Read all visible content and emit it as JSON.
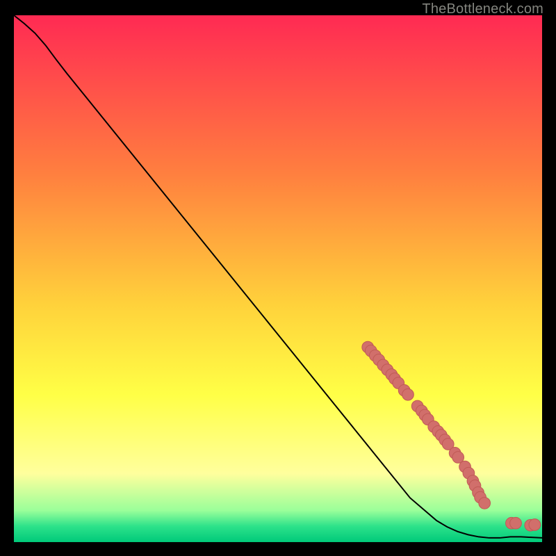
{
  "header": {
    "attribution": "TheBottleneck.com"
  },
  "colors": {
    "page_bg": "#000000",
    "gradient_top": "#ff2a53",
    "gradient_mid_hi": "#ff7f3f",
    "gradient_mid": "#ffd23b",
    "gradient_mid_lo": "#ffff46",
    "gradient_pale": "#ffff9d",
    "gradient_green_a": "#9aff9a",
    "gradient_green_b": "#2de28a",
    "gradient_bottom": "#00c97a",
    "curve": "#000000",
    "point_fill": "#d16f6b",
    "point_stroke": "#c05a55"
  },
  "chart_data": {
    "type": "line",
    "title": "",
    "xlabel": "",
    "ylabel": "",
    "xlim": [
      0,
      100
    ],
    "ylim": [
      0,
      100
    ],
    "grid": false,
    "legend": false,
    "curve": [
      {
        "x": 0.0,
        "y": 100.0
      },
      {
        "x": 2.0,
        "y": 98.4
      },
      {
        "x": 4.0,
        "y": 96.6
      },
      {
        "x": 6.0,
        "y": 94.3
      },
      {
        "x": 8.0,
        "y": 91.6
      },
      {
        "x": 10.0,
        "y": 89.0
      },
      {
        "x": 15.0,
        "y": 82.8
      },
      {
        "x": 20.0,
        "y": 76.6
      },
      {
        "x": 25.0,
        "y": 70.4
      },
      {
        "x": 30.0,
        "y": 64.2
      },
      {
        "x": 35.0,
        "y": 58.0
      },
      {
        "x": 40.0,
        "y": 51.8
      },
      {
        "x": 45.0,
        "y": 45.6
      },
      {
        "x": 50.0,
        "y": 39.4
      },
      {
        "x": 55.0,
        "y": 33.2
      },
      {
        "x": 60.0,
        "y": 27.0
      },
      {
        "x": 65.0,
        "y": 20.8
      },
      {
        "x": 70.0,
        "y": 14.6
      },
      {
        "x": 75.0,
        "y": 8.4
      },
      {
        "x": 80.0,
        "y": 4.1
      },
      {
        "x": 82.0,
        "y": 2.9
      },
      {
        "x": 84.0,
        "y": 2.0
      },
      {
        "x": 86.0,
        "y": 1.4
      },
      {
        "x": 88.0,
        "y": 1.0
      },
      {
        "x": 90.0,
        "y": 0.8
      },
      {
        "x": 92.0,
        "y": 0.8
      },
      {
        "x": 94.0,
        "y": 1.0
      },
      {
        "x": 96.0,
        "y": 1.0
      },
      {
        "x": 98.0,
        "y": 0.9
      },
      {
        "x": 100.0,
        "y": 0.8
      }
    ],
    "points": [
      {
        "x": 67.0,
        "y": 37.0
      },
      {
        "x": 67.6,
        "y": 36.3
      },
      {
        "x": 68.4,
        "y": 35.4
      },
      {
        "x": 69.1,
        "y": 34.6
      },
      {
        "x": 69.9,
        "y": 33.6
      },
      {
        "x": 70.7,
        "y": 32.7
      },
      {
        "x": 71.5,
        "y": 31.8
      },
      {
        "x": 72.1,
        "y": 31.0
      },
      {
        "x": 72.8,
        "y": 30.2
      },
      {
        "x": 73.9,
        "y": 28.8
      },
      {
        "x": 74.6,
        "y": 28.0
      },
      {
        "x": 76.4,
        "y": 25.8
      },
      {
        "x": 77.2,
        "y": 24.9
      },
      {
        "x": 77.8,
        "y": 24.1
      },
      {
        "x": 78.4,
        "y": 23.3
      },
      {
        "x": 79.5,
        "y": 21.9
      },
      {
        "x": 80.3,
        "y": 21.0
      },
      {
        "x": 80.9,
        "y": 20.3
      },
      {
        "x": 81.6,
        "y": 19.4
      },
      {
        "x": 82.2,
        "y": 18.6
      },
      {
        "x": 83.5,
        "y": 16.9
      },
      {
        "x": 84.1,
        "y": 16.1
      },
      {
        "x": 85.4,
        "y": 14.3
      },
      {
        "x": 86.1,
        "y": 13.1
      },
      {
        "x": 86.9,
        "y": 11.6
      },
      {
        "x": 87.3,
        "y": 10.7
      },
      {
        "x": 87.9,
        "y": 9.4
      },
      {
        "x": 88.3,
        "y": 8.5
      },
      {
        "x": 89.1,
        "y": 7.4
      },
      {
        "x": 94.2,
        "y": 3.6
      },
      {
        "x": 95.0,
        "y": 3.6
      },
      {
        "x": 97.8,
        "y": 3.2
      },
      {
        "x": 98.6,
        "y": 3.3
      }
    ],
    "point_radius": 1.1
  }
}
